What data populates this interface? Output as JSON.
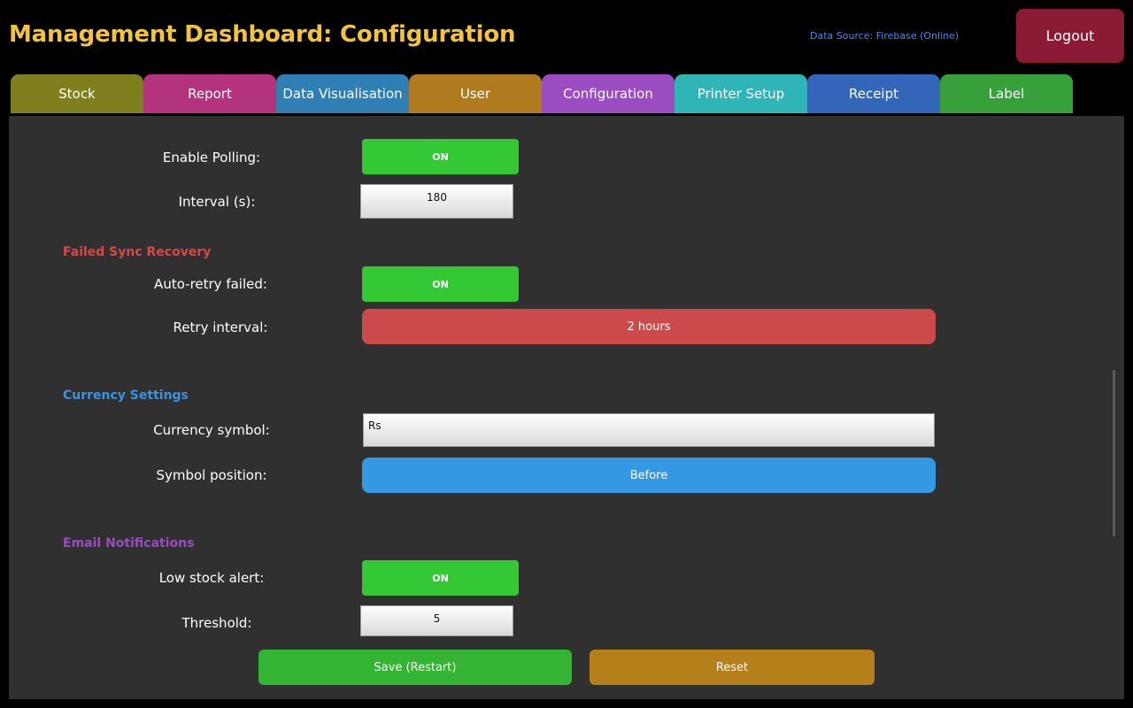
{
  "header": {
    "title": "Management Dashboard: Configuration",
    "data_source": "Data Source: Firebase (Online)",
    "logout_label": "Logout"
  },
  "tabs": [
    {
      "label": "Stock",
      "color": "#7f7f1e"
    },
    {
      "label": "Report",
      "color": "#b3337d"
    },
    {
      "label": "Data Visualisation",
      "color": "#2f7fb5"
    },
    {
      "label": "User",
      "color": "#b07a1f"
    },
    {
      "label": "Configuration",
      "color": "#9b4cc0"
    },
    {
      "label": "Printer Setup",
      "color": "#2fb5b5"
    },
    {
      "label": "Receipt",
      "color": "#3366b8"
    },
    {
      "label": "Label",
      "color": "#37a03a"
    }
  ],
  "polling": {
    "enable_label": "Enable Polling:",
    "enable_value": "ON",
    "interval_label": "Interval (s):",
    "interval_value": "180"
  },
  "failed_sync": {
    "heading": "Failed Sync Recovery",
    "heading_color": "#d94848",
    "auto_retry_label": "Auto-retry failed:",
    "auto_retry_value": "ON",
    "retry_interval_label": "Retry interval:",
    "retry_interval_value": "2 hours"
  },
  "currency": {
    "heading": "Currency Settings",
    "heading_color": "#3a93e0",
    "symbol_label": "Currency symbol:",
    "symbol_value": "Rs",
    "position_label": "Symbol position:",
    "position_value": "Before"
  },
  "email": {
    "heading": "Email Notifications",
    "heading_color": "#9b4cc0",
    "low_stock_label": "Low stock alert:",
    "low_stock_value": "ON",
    "threshold_label": "Threshold:",
    "threshold_value": "5"
  },
  "actions": {
    "save_label": "Save (Restart)",
    "reset_label": "Reset"
  },
  "colors": {
    "title": "#f2c43b",
    "toggle_on": "#34c934",
    "retry_interval": "#cc4a4a",
    "symbol_position": "#3598e2",
    "save": "#33b533",
    "reset": "#b57f1a",
    "logout": "#8b1a35"
  }
}
